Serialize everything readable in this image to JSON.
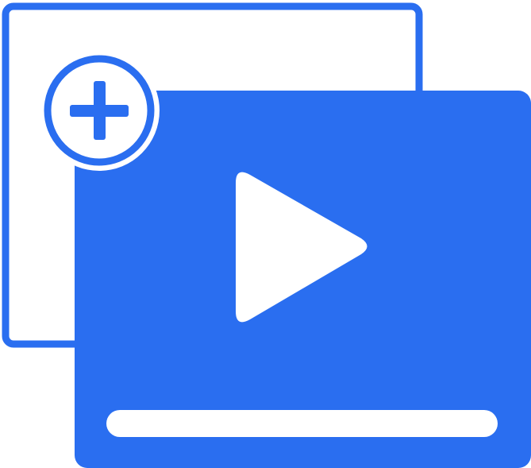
{
  "icon": {
    "name": "add-video-icon",
    "parts": {
      "back_frame": "window-outline-icon",
      "front_frame": "video-player-icon",
      "play": "play-icon",
      "badge": "plus-circle-icon",
      "progress": "progress-bar"
    }
  },
  "colors": {
    "primary": "#2A6EF0",
    "background": "#FFFFFF"
  }
}
